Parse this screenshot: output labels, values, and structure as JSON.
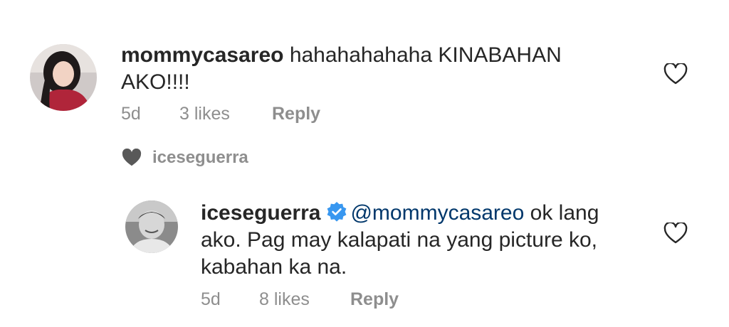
{
  "comments": [
    {
      "username": "mommycasareo",
      "text": "hahahahahaha KINABAHAN AKO!!!!",
      "age": "5d",
      "likes": "3 likes",
      "reply_label": "Reply",
      "like_icon": "heart-outline-icon"
    },
    {
      "username": "iceseguerra",
      "verified": true,
      "mention": "@mommycasareo",
      "text": "ok lang ako. Pag may kalapati na yang picture ko, kabahan ka na.",
      "age": "5d",
      "likes": "8 likes",
      "reply_label": "Reply",
      "like_icon": "heart-outline-icon"
    }
  ],
  "liked_by": {
    "icon": "heart-filled-icon",
    "username": "iceseguerra"
  },
  "colors": {
    "text": "#262626",
    "meta": "#8e8e8e",
    "mention": "#00376b",
    "verified": "#3897f0"
  }
}
